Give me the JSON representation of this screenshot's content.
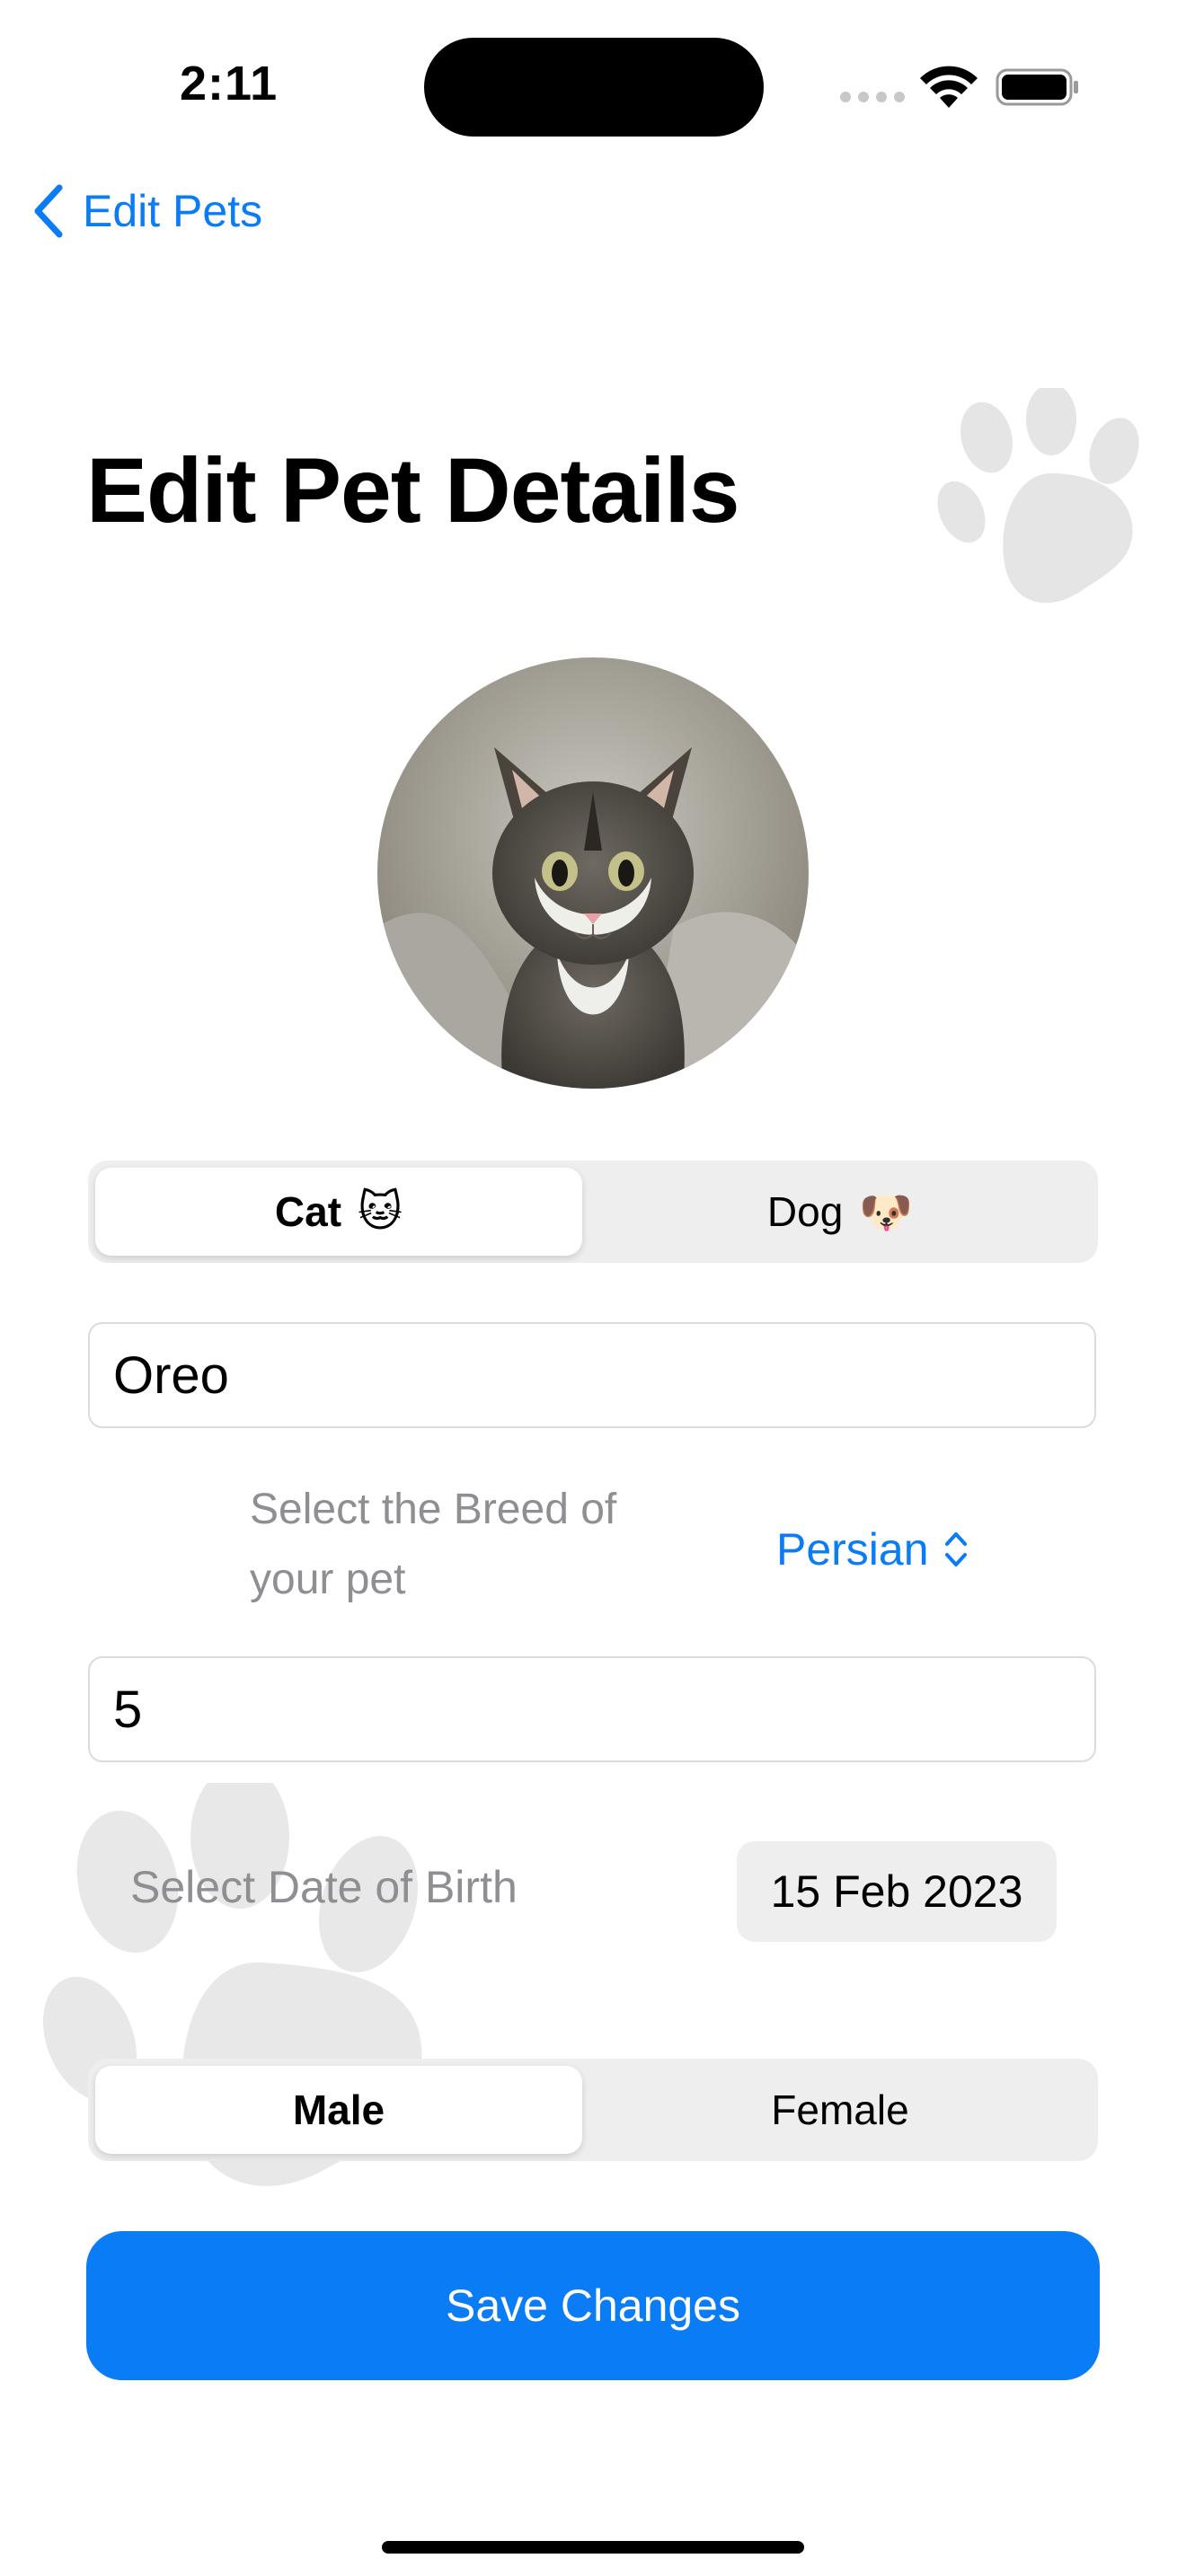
{
  "status_bar": {
    "time": "2:11"
  },
  "nav": {
    "back_label": "Edit Pets"
  },
  "page": {
    "title": "Edit Pet Details"
  },
  "pet_type": {
    "options": [
      {
        "label": "Cat",
        "emoji": "🐱",
        "selected": true
      },
      {
        "label": "Dog",
        "emoji": "🐶",
        "selected": false
      }
    ]
  },
  "form": {
    "name_value": "Oreo",
    "breed_label": "Select the Breed of your pet",
    "breed_value": "Persian",
    "age_value": "5",
    "dob_label": "Select Date of Birth",
    "dob_value": "15 Feb 2023"
  },
  "gender": {
    "options": [
      {
        "label": "Male",
        "selected": true
      },
      {
        "label": "Female",
        "selected": false
      }
    ]
  },
  "actions": {
    "save_label": "Save Changes"
  },
  "colors": {
    "accent": "#0a7cf5",
    "segment_bg": "#eeeeee",
    "placeholder_gray": "#8e8e93"
  },
  "icons": {
    "back": "chevron-left-icon",
    "picker": "chevron-up-down-icon",
    "decor": "paw-print-icon"
  }
}
